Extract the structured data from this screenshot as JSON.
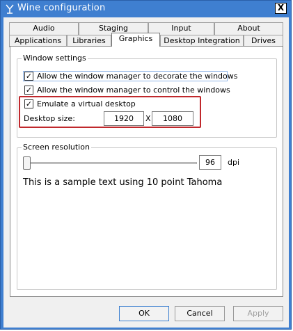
{
  "window": {
    "title": "Wine configuration",
    "close_glyph": "X"
  },
  "tabs": {
    "row1": [
      "Audio",
      "Staging",
      "Input",
      "About"
    ],
    "row2": [
      "Applications",
      "Libraries",
      "Graphics",
      "Desktop Integration",
      "Drives"
    ],
    "active": "Graphics"
  },
  "window_settings": {
    "title": "Window settings",
    "decorate": {
      "label": "Allow the window manager to decorate the windows",
      "checked": true
    },
    "control": {
      "label": "Allow the window manager to control the windows",
      "checked": true
    },
    "virtual_desktop": {
      "label": "Emulate a virtual desktop",
      "checked": true
    },
    "desktop_size_label": "Desktop size:",
    "width": "1920",
    "separator": "X",
    "height": "1080"
  },
  "screen_resolution": {
    "title": "Screen resolution",
    "dpi_value": "96",
    "dpi_unit": "dpi",
    "sample_text": "This is a sample text using 10 point Tahoma"
  },
  "buttons": {
    "ok": "OK",
    "cancel": "Cancel",
    "apply": "Apply"
  },
  "colors": {
    "title_bar": "#3f7fd0",
    "highlight_box": "#c0282c"
  },
  "icons": {
    "title": "wine-glass-icon"
  }
}
